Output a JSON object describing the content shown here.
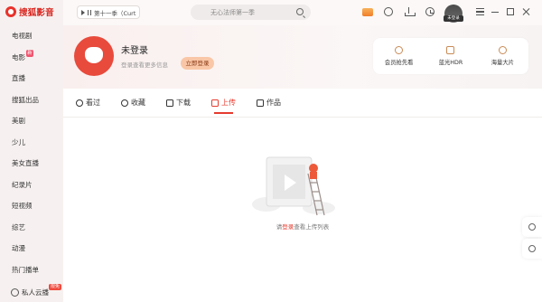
{
  "app": {
    "name": "搜狐影音"
  },
  "sidebar": {
    "items": [
      {
        "label": "电视剧"
      },
      {
        "label": "电影",
        "badge": "新"
      },
      {
        "label": "直播"
      },
      {
        "label": "搜狐出品"
      },
      {
        "label": "美剧"
      },
      {
        "label": "少儿"
      },
      {
        "label": "美女直播"
      },
      {
        "label": "纪录片"
      },
      {
        "label": "短视频"
      },
      {
        "label": "综艺"
      },
      {
        "label": "动漫"
      },
      {
        "label": "热门播单"
      }
    ],
    "cloud": {
      "label": "私人云播",
      "badge": "限免"
    }
  },
  "topbar": {
    "mini_player_text": "第十一季（Curt",
    "search_placeholder": "无心法师第一季",
    "avatar_tag": "未登录"
  },
  "profile": {
    "name": "未登录",
    "hint": "登录查看更多信息",
    "login_button": "立即登录"
  },
  "perks": [
    {
      "label": "会员抢先看",
      "icon": "play-circle-icon"
    },
    {
      "label": "蓝光HDR",
      "icon": "hdr-icon"
    },
    {
      "label": "海量大片",
      "icon": "layers-icon"
    }
  ],
  "tabs": [
    {
      "label": "看过",
      "icon": "clock-icon"
    },
    {
      "label": "收藏",
      "icon": "heart-icon"
    },
    {
      "label": "下载",
      "icon": "download-icon"
    },
    {
      "label": "上传",
      "icon": "upload-icon",
      "active": true
    },
    {
      "label": "作品",
      "icon": "video-icon"
    }
  ],
  "empty": {
    "prefix": "请",
    "link": "登录",
    "suffix": "查看上传列表"
  },
  "colors": {
    "accent": "#e63b2e",
    "brand": "#e8322c"
  }
}
